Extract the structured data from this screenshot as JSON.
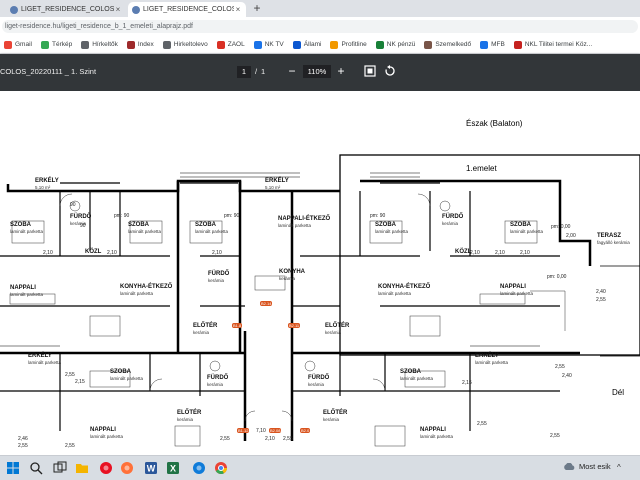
{
  "browser": {
    "tabs": [
      {
        "title": "LIGET_RESIDENCE_COLOS_202201",
        "active": false
      },
      {
        "title": "LIGET_RESIDENCE_COLOS_202201",
        "active": true
      }
    ],
    "new_tab_label": "+",
    "url": "liget-residence.hu/ligeti_residence_b_1_emeleti_alaprajz.pdf"
  },
  "bookmarks": [
    {
      "label": "Gmail",
      "icon": "gmail-icon",
      "color": "#ea4335"
    },
    {
      "label": "Térkép",
      "icon": "maps-icon",
      "color": "#34a853"
    },
    {
      "label": "Hírkeltők",
      "icon": "news-icon",
      "color": "#5f6368"
    },
    {
      "label": "Index",
      "icon": "index-icon",
      "color": "#9e2a2b"
    },
    {
      "label": "Hirkeltolevo",
      "icon": "page-icon",
      "color": "#5f6368"
    },
    {
      "label": "ZAOL",
      "icon": "zaol-icon",
      "color": "#d93025"
    },
    {
      "label": "NK TV",
      "icon": "tv-icon",
      "color": "#1a73e8"
    },
    {
      "label": "Állami",
      "icon": "gov-icon",
      "color": "#0b57d0"
    },
    {
      "label": "Profitline",
      "icon": "profit-icon",
      "color": "#f29900"
    },
    {
      "label": "NK pénzü",
      "icon": "bank-icon",
      "color": "#188038"
    },
    {
      "label": "Szemelkedő",
      "icon": "page-icon",
      "color": "#795548"
    },
    {
      "label": "MFB",
      "icon": "mfb-icon",
      "color": "#1a73e8"
    },
    {
      "label": "NKL Tilitei termei Köz...",
      "icon": "folder-icon",
      "color": "#c5221f"
    }
  ],
  "pdf_toolbar": {
    "title": "COLOS_20220111 _ 1. Szint",
    "page_current": "1",
    "page_separator": "/",
    "page_total": "1",
    "zoom_out": "−",
    "zoom": "110%",
    "zoom_in": "+"
  },
  "plan": {
    "north": "Észak (Balaton)",
    "floor": "1.emelet",
    "south": "Dél",
    "rooms": [
      {
        "name": "ERKÉLY",
        "sub": "5,10 m²"
      },
      {
        "name": "ERKÉLY",
        "sub": "5,10 m²"
      },
      {
        "name": "SZOBA",
        "sub": "laminált parketta"
      },
      {
        "name": "FÜRDŐ",
        "sub": "kerámia"
      },
      {
        "name": "SZOBA",
        "sub": "laminált parketta"
      },
      {
        "name": "SZOBA",
        "sub": "laminált parketta"
      },
      {
        "name": "NAPPALI-ÉTKEZŐ",
        "sub": "laminált parketta"
      },
      {
        "name": "SZOBA",
        "sub": "laminált parketta"
      },
      {
        "name": "FÜRDŐ",
        "sub": "kerámia"
      },
      {
        "name": "SZOBA",
        "sub": "laminált parketta"
      },
      {
        "name": "TERASZ",
        "sub": "fagyálló kerámia"
      },
      {
        "name": "FÜRDŐ",
        "sub": "kerámia"
      },
      {
        "name": "KONYHA",
        "sub": "kerámia"
      },
      {
        "name": "NAPPALI",
        "sub": "laminált parketta"
      },
      {
        "name": "KONYHA-ÉTKEZŐ",
        "sub": "laminált parketta"
      },
      {
        "name": "KONYHA-ÉTKEZŐ",
        "sub": "laminált parketta"
      },
      {
        "name": "NAPPALI",
        "sub": "laminált parketta"
      },
      {
        "name": "ELŐTÉR",
        "sub": "kerámia"
      },
      {
        "name": "ELŐTÉR",
        "sub": "kerámia"
      },
      {
        "name": "ERKÉLY",
        "sub": "laminált parketta"
      },
      {
        "name": "ERKÉLY",
        "sub": "laminált parketta"
      },
      {
        "name": "SZOBA",
        "sub": "laminált parketta"
      },
      {
        "name": "FÜRDŐ",
        "sub": "kerámia"
      },
      {
        "name": "FÜRDŐ",
        "sub": "kerámia"
      },
      {
        "name": "SZOBA",
        "sub": "laminált parketta"
      },
      {
        "name": "NAPPALI",
        "sub": "laminált parketta"
      },
      {
        "name": "NAPPALI",
        "sub": "laminált parketta"
      },
      {
        "name": "ELŐTÉR",
        "sub": "kerámia"
      },
      {
        "name": "ELŐTÉR",
        "sub": "kerámia"
      },
      {
        "name": "KÖZL",
        "sub": ""
      },
      {
        "name": "KÖZL",
        "sub": ""
      }
    ],
    "dims": [
      "90",
      "90",
      "pm: 90",
      "pm: 90",
      "pm: 90",
      "2,10",
      "2,10",
      "2,10",
      "2,10",
      "2,00",
      "2,10",
      "2,10",
      "2,40",
      "2,55",
      "2,55",
      "2,15",
      "2,15",
      "2,46",
      "2,55",
      "2,55",
      "2,55",
      "pm: 0,00",
      "pm: 0,00",
      "2,40",
      "2,55",
      "2,55",
      "7,10",
      "2,10",
      "2,55",
      "2,55"
    ],
    "markers": [
      "B2.14",
      "B1.8",
      "B2.11",
      "B1.12",
      "B2.08",
      "B2.0"
    ]
  },
  "taskbar": {
    "apps": [
      {
        "name": "start-button",
        "color": "#0078d4"
      },
      {
        "name": "search-icon",
        "color": "#222"
      },
      {
        "name": "task-view-icon",
        "color": "#222"
      },
      {
        "name": "file-explorer-icon",
        "color": "#f4b400"
      },
      {
        "name": "opera-icon",
        "color": "#e81123"
      },
      {
        "name": "firefox-icon",
        "color": "#ff7139"
      },
      {
        "name": "word-icon",
        "color": "#2b579a"
      },
      {
        "name": "excel-icon",
        "color": "#217346"
      },
      {
        "name": "edge-icon",
        "color": "#0f7bd9"
      },
      {
        "name": "chrome-icon",
        "color": "#34a853"
      }
    ],
    "weather": "Most esik"
  }
}
